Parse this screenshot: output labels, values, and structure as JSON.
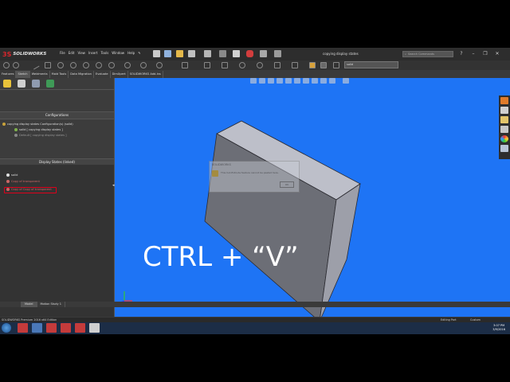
{
  "app": {
    "brand": "SOLIDWORKS",
    "document_title": "copying display states",
    "menu": [
      "File",
      "Edit",
      "View",
      "Insert",
      "Tools",
      "Window",
      "Help"
    ],
    "search_placeholder": "Search Commands",
    "active_config": "solid"
  },
  "command_tabs": [
    "Features",
    "Sketch",
    "Weldments",
    "Mold Tools",
    "Data Migration",
    "Evaluate",
    "DimXpert",
    "SOLIDWORKS Add-Ins"
  ],
  "active_command_tab": "Sketch",
  "left_panel": {
    "configurations_header": "Configurations",
    "config_root": "copying display states Configuration(s)  (solid)",
    "config_item": "solid [ copying display states ]",
    "config_sub": "Default [ copying display states ]",
    "display_states_header": "Display States (linked)",
    "display_states": [
      "solid",
      "Copy of transparent",
      "Copy of Copy of transparent"
    ]
  },
  "viewport": {
    "caption": "CTRL + “V”",
    "dialog_title": "SOLIDWORKS",
    "dialog_message": "This Cut-Extrude feature cannot be pasted here.",
    "dialog_button": "OK"
  },
  "bottom_tabs": [
    "Model",
    "Motion Study 1"
  ],
  "active_bottom_tab": "Model",
  "status": {
    "left": "SOLIDWORKS Premium 2016 x64 Edition",
    "mode": "Editing Part",
    "units": "Custom"
  },
  "taskbar": {
    "time": "3:07 PM",
    "date": "3/9/2016"
  },
  "colors": {
    "viewport_bg": "#1e74f5",
    "highlight_box": "#e0001b",
    "panel_bg": "#3c3c3c"
  }
}
